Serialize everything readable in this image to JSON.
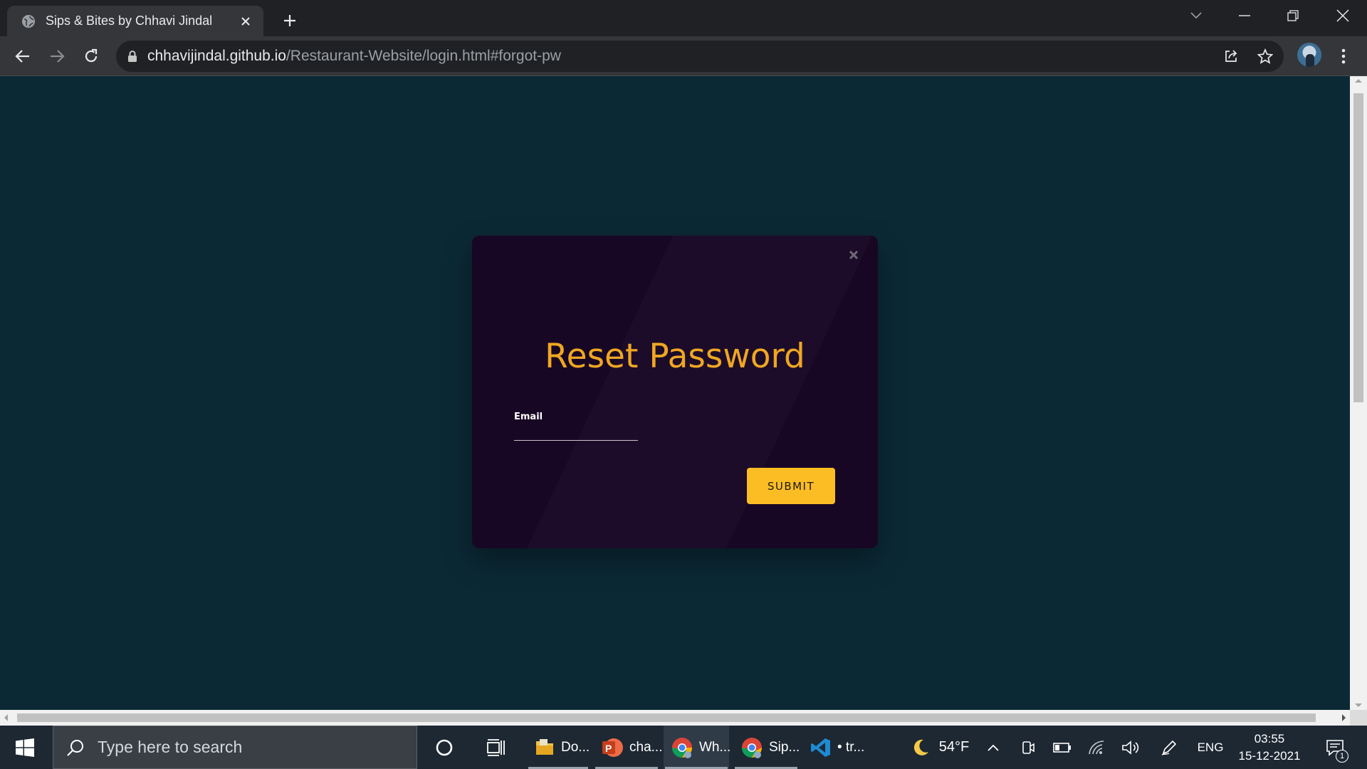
{
  "browser": {
    "tab_title": "Sips & Bites by Chhavi Jindal",
    "url_host": "chhavijindal.github.io",
    "url_path": "/Restaurant-Website/login.html#forgot-pw"
  },
  "modal": {
    "title": "Reset Password",
    "email_label": "Email",
    "email_value": "",
    "submit_label": "SUBMIT"
  },
  "colors": {
    "page_background": "#0b2935",
    "modal_background": "#180724",
    "title_color": "#efa722",
    "button_color": "#fcbd24"
  },
  "taskbar": {
    "search_placeholder": "Type here to search",
    "apps": [
      {
        "name": "file-explorer",
        "label": "Do..."
      },
      {
        "name": "powerpoint",
        "label": "cha..."
      },
      {
        "name": "chrome-whatsapp",
        "label": "Wh..."
      },
      {
        "name": "chrome-sips",
        "label": "Sip..."
      },
      {
        "name": "vscode",
        "label": "• tr..."
      }
    ],
    "weather_temp": "54°F",
    "language": "ENG",
    "time": "03:55",
    "date": "15-12-2021",
    "notification_count": "1"
  }
}
